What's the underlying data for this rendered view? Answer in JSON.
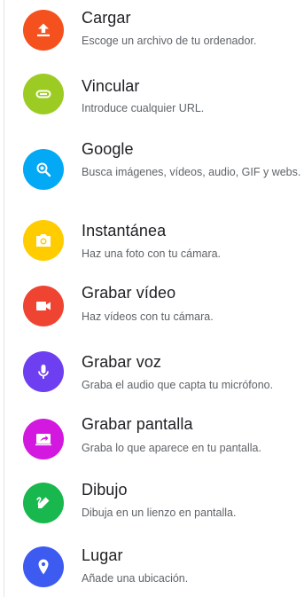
{
  "items": [
    {
      "id": "cargar",
      "icon": "upload-icon",
      "color": "#f4511e",
      "title": "Cargar",
      "description": "Escoge un archivo de tu ordenador."
    },
    {
      "id": "vincular",
      "icon": "link-icon",
      "color": "#9ccc23",
      "title": "Vincular",
      "description": "Introduce cualquier URL."
    },
    {
      "id": "google",
      "icon": "search-web-icon",
      "color": "#03a9f4",
      "title": "Google",
      "description": "Busca imágenes, vídeos, audio, GIF y webs."
    },
    {
      "id": "instantanea",
      "icon": "camera-icon",
      "color": "#ffcc00",
      "title": "Instantánea",
      "description": "Haz una foto con tu cámara."
    },
    {
      "id": "grabar-video",
      "icon": "video-camera-icon",
      "color": "#ef4432",
      "title": "Grabar vídeo",
      "description": "Haz vídeos con tu cámara."
    },
    {
      "id": "grabar-voz",
      "icon": "microphone-icon",
      "color": "#6d3ff0",
      "title": "Grabar voz",
      "description": "Graba el audio que capta tu micrófono."
    },
    {
      "id": "grabar-pantalla",
      "icon": "screen-share-icon",
      "color": "#d318e0",
      "title": "Grabar pantalla",
      "description": "Graba lo que aparece en tu pantalla."
    },
    {
      "id": "dibujo",
      "icon": "draw-icon",
      "color": "#18b84e",
      "title": "Dibujo",
      "description": "Dibuja en un lienzo en pantalla."
    },
    {
      "id": "lugar",
      "icon": "location-pin-icon",
      "color": "#3d5af1",
      "title": "Lugar",
      "description": "Añade una ubicación."
    }
  ]
}
